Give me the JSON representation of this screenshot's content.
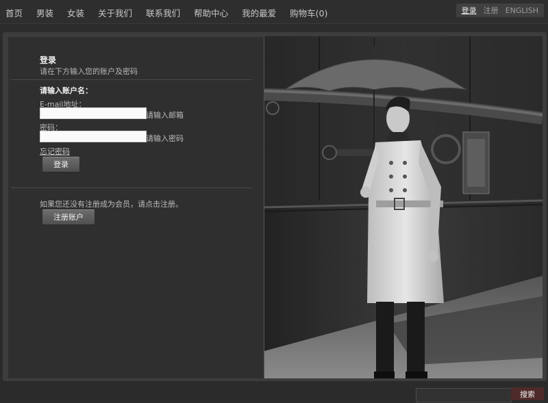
{
  "nav": {
    "items": [
      "首页",
      "男装",
      "女装",
      "关于我们",
      "联系我们",
      "帮助中心",
      "我的最爱",
      "购物车(0)"
    ]
  },
  "account": {
    "login": "登录",
    "register": "注册",
    "language": "ENGLISH"
  },
  "login": {
    "title": "登录",
    "subtitle": "请在下方输入您的账户及密码",
    "account_heading": "请输入账户名：",
    "email_label": "E-mail地址：",
    "email_hint": "请输入邮箱",
    "password_label": "密码：",
    "password_hint": "请输入密码",
    "forgot": "忘记密码",
    "submit": "登录"
  },
  "register": {
    "prompt": "如果您还没有注册成为会员，请点击注册。",
    "button": "注册账户"
  },
  "search": {
    "button": "搜索"
  },
  "colors": {
    "background": "#2b2b2b",
    "panel": "#2f2f2f",
    "search_button": "#4e2a2a"
  }
}
